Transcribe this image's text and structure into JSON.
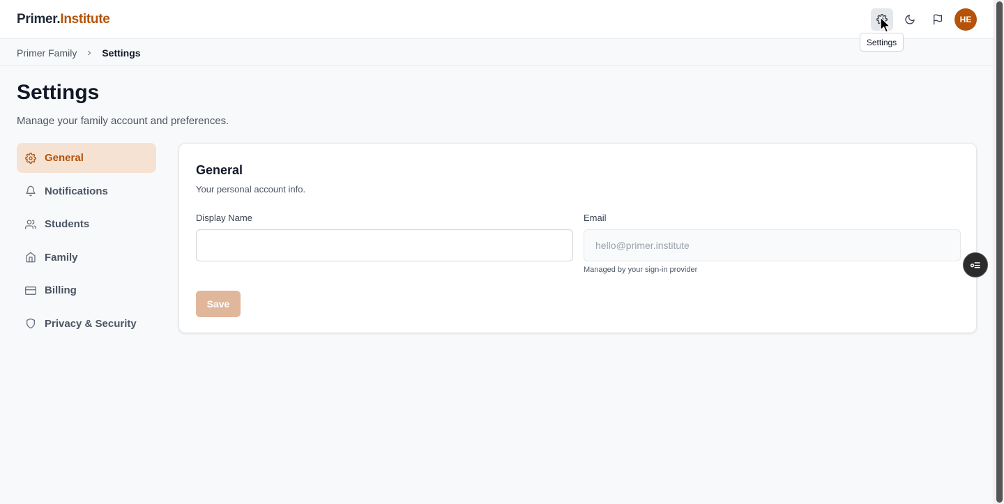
{
  "header": {
    "logo_part1": "Primer.",
    "logo_part2": "Institute",
    "icons": [
      "settings-icon",
      "moon-icon",
      "flag-icon"
    ],
    "avatar_initials": "HE",
    "tooltip": "Settings"
  },
  "breadcrumb": {
    "items": [
      "Primer Family",
      "Settings"
    ]
  },
  "page": {
    "title": "Settings",
    "subtitle": "Manage your family account and preferences."
  },
  "sidebar": {
    "items": [
      {
        "label": "General",
        "icon": "gear-icon",
        "active": true
      },
      {
        "label": "Notifications",
        "icon": "bell-icon",
        "active": false
      },
      {
        "label": "Students",
        "icon": "users-icon",
        "active": false
      },
      {
        "label": "Family",
        "icon": "home-icon",
        "active": false
      },
      {
        "label": "Billing",
        "icon": "credit-card-icon",
        "active": false
      },
      {
        "label": "Privacy & Security",
        "icon": "shield-icon",
        "active": false
      }
    ]
  },
  "card": {
    "title": "General",
    "subtitle": "Your personal account info.",
    "display_name_label": "Display Name",
    "display_name_value": "",
    "email_label": "Email",
    "email_placeholder": "hello@primer.institute",
    "email_hint": "Managed by your sign-in provider",
    "save_label": "Save"
  },
  "colors": {
    "accent": "#b45309",
    "active_nav_bg": "#f6e2d3",
    "save_disabled": "#e0b79a"
  }
}
